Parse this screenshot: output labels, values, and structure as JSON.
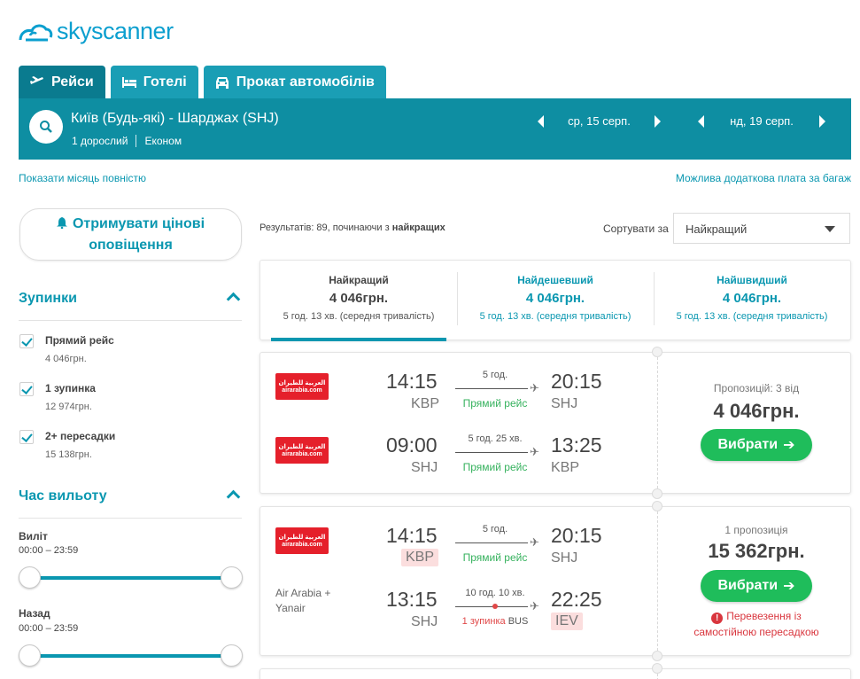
{
  "brand": {
    "name": "skyscanner",
    "color": "#0b9fcf"
  },
  "tabs": [
    {
      "label": "Рейси",
      "icon": "plane-icon"
    },
    {
      "label": "Готелі",
      "icon": "bed-icon"
    },
    {
      "label": "Прокат автомобілів",
      "icon": "car-icon"
    }
  ],
  "search": {
    "route": "Київ (Будь-які) - Шарджах (SHJ)",
    "passengers": "1 дорослий",
    "cabin": "Економ",
    "depart_date": "ср, 15 серп.",
    "return_date": "нд, 19 серп."
  },
  "links": {
    "whole_month": "Показати місяць повністю",
    "baggage": "Можлива додаткова плата за багаж"
  },
  "alerts_button": {
    "line1": "Отримувати цінові",
    "line2": "оповіщення"
  },
  "filters": {
    "stops": {
      "title": "Зупинки",
      "items": [
        {
          "label": "Прямий рейс",
          "price": "4 046грн.",
          "checked": true
        },
        {
          "label": "1 зупинка",
          "price": "12 974грн.",
          "checked": true
        },
        {
          "label": "2+ пересадки",
          "price": "15 138грн.",
          "checked": true
        }
      ]
    },
    "departure_time": {
      "title": "Час вильоту",
      "outbound": {
        "label": "Виліт",
        "range": "00:00 – 23:59"
      },
      "return": {
        "label": "Назад",
        "range": "00:00 – 23:59"
      }
    }
  },
  "results": {
    "count_prefix": "Результатів: 89, починаючи з ",
    "count_bold": "найкращих",
    "sort_label": "Сортувати за",
    "sort_value": "Найкращий"
  },
  "sort_tabs": [
    {
      "title": "Найкращий",
      "price": "4 046грн.",
      "duration": "5 год. 13 хв. (середня тривалість)",
      "active": true
    },
    {
      "title": "Найдешевший",
      "price": "4 046грн.",
      "duration": "5 год. 13 хв. (середня тривалість)",
      "active": false
    },
    {
      "title": "Найшвидший",
      "price": "4 046грн.",
      "duration": "5 год. 13 хв. (середня тривалість)",
      "active": false
    }
  ],
  "cards": [
    {
      "legs": [
        {
          "airline": "airarabia.com",
          "dep_time": "14:15",
          "dep_code": "KBP",
          "duration": "5 год.",
          "stops": "Прямий рейс",
          "arr_time": "20:15",
          "arr_code": "SHJ"
        },
        {
          "airline": "airarabia.com",
          "dep_time": "09:00",
          "dep_code": "SHJ",
          "duration": "5 год. 25 хв.",
          "stops": "Прямий рейс",
          "arr_time": "13:25",
          "arr_code": "KBP"
        }
      ],
      "offers": "Пропозицій: 3 від",
      "price": "4 046грн.",
      "button": "Вибрати"
    },
    {
      "legs": [
        {
          "airline": "airarabia.com",
          "dep_time": "14:15",
          "dep_code": "KBP",
          "duration": "5 год.",
          "stops": "Прямий рейс",
          "arr_time": "20:15",
          "arr_code": "SHJ"
        },
        {
          "airline_text_1": "Air Arabia +",
          "airline_text_2": "Yanair",
          "dep_time": "13:15",
          "dep_code": "SHJ",
          "duration": "10 год. 10 хв.",
          "stops_red": "1 зупинка",
          "stops_bus": "BUS",
          "arr_time": "22:25",
          "arr_code": "IEV"
        }
      ],
      "offers": "1 пропозиція",
      "price": "15 362грн.",
      "button": "Вибрати",
      "warning_1": "Перевезення із",
      "warning_2": "самостійною пересадкою"
    }
  ],
  "airline_logo_arabic": "العربية للطيران",
  "colors": {
    "teal": "#0e8ea2",
    "tab_active": "#0a7b8f",
    "green": "#1fbd5b",
    "red": "#d9363e"
  }
}
